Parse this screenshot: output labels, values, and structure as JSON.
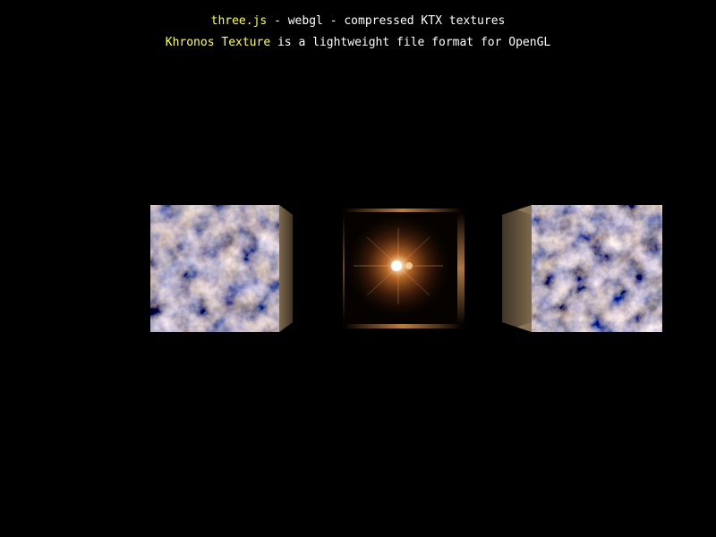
{
  "info": {
    "line1": {
      "link_text": "three.js",
      "rest_text": " - webgl - compressed KTX textures"
    },
    "line2": {
      "link_text": "Khronos Texture",
      "rest_text": " is a lightweight file format for OpenGL"
    }
  },
  "colors": {
    "background": "#000000",
    "text": "#ffffff",
    "link": "#ffff55",
    "marble_dark": "#2b241b",
    "marble_mid": "#7a6242",
    "marble_light": "#e8dcc4",
    "marble_blue": "#6a8a96",
    "glow": "#ffb060"
  },
  "scene": {
    "objects": [
      {
        "name": "marble-cube-left"
      },
      {
        "name": "glowing-cube-center"
      },
      {
        "name": "marble-cube-right"
      }
    ]
  }
}
